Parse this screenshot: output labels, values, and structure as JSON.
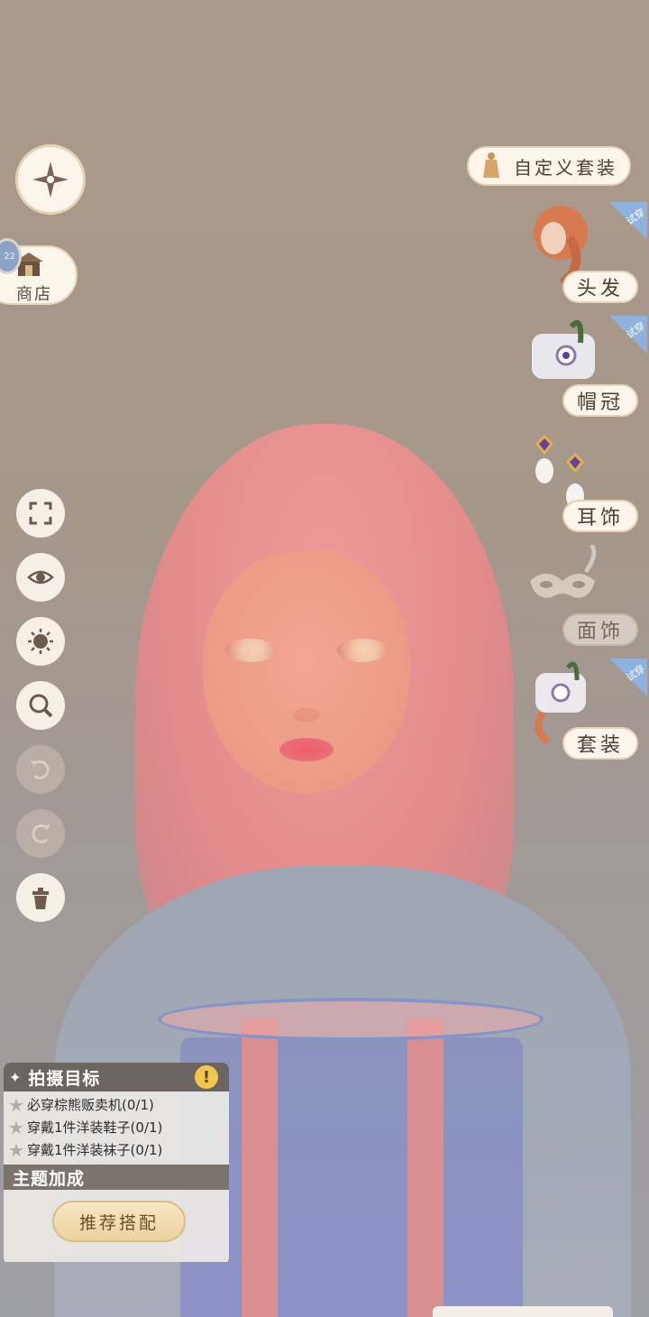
{
  "shop": {
    "label": "商店",
    "badge": "22"
  },
  "custom_outfit": {
    "label": "自定义套装"
  },
  "categories": [
    {
      "label": "头发",
      "tag": "试穿"
    },
    {
      "label": "帽冠",
      "tag": "试穿"
    },
    {
      "label": "耳饰"
    },
    {
      "label": "面饰"
    },
    {
      "label": "套装",
      "tag": "试穿"
    }
  ],
  "tools": [
    "fullscreen-icon",
    "eye-icon",
    "sun-icon",
    "zoom-icon",
    "undo-icon",
    "redo-icon",
    "trash-icon"
  ],
  "photo_goals": {
    "title": "拍摄目标",
    "warning": "!",
    "items": [
      "必穿棕熊贩卖机(0/1)",
      "穿戴1件洋装鞋子(0/1)",
      "穿戴1件洋装袜子(0/1)"
    ]
  },
  "theme_bonus": {
    "title": "主题加成",
    "recommend_label": "推荐搭配"
  },
  "colors": {
    "accent": "#e6d3b5",
    "button_bg": "#fbf5ec",
    "tag": "#8fb1de"
  }
}
